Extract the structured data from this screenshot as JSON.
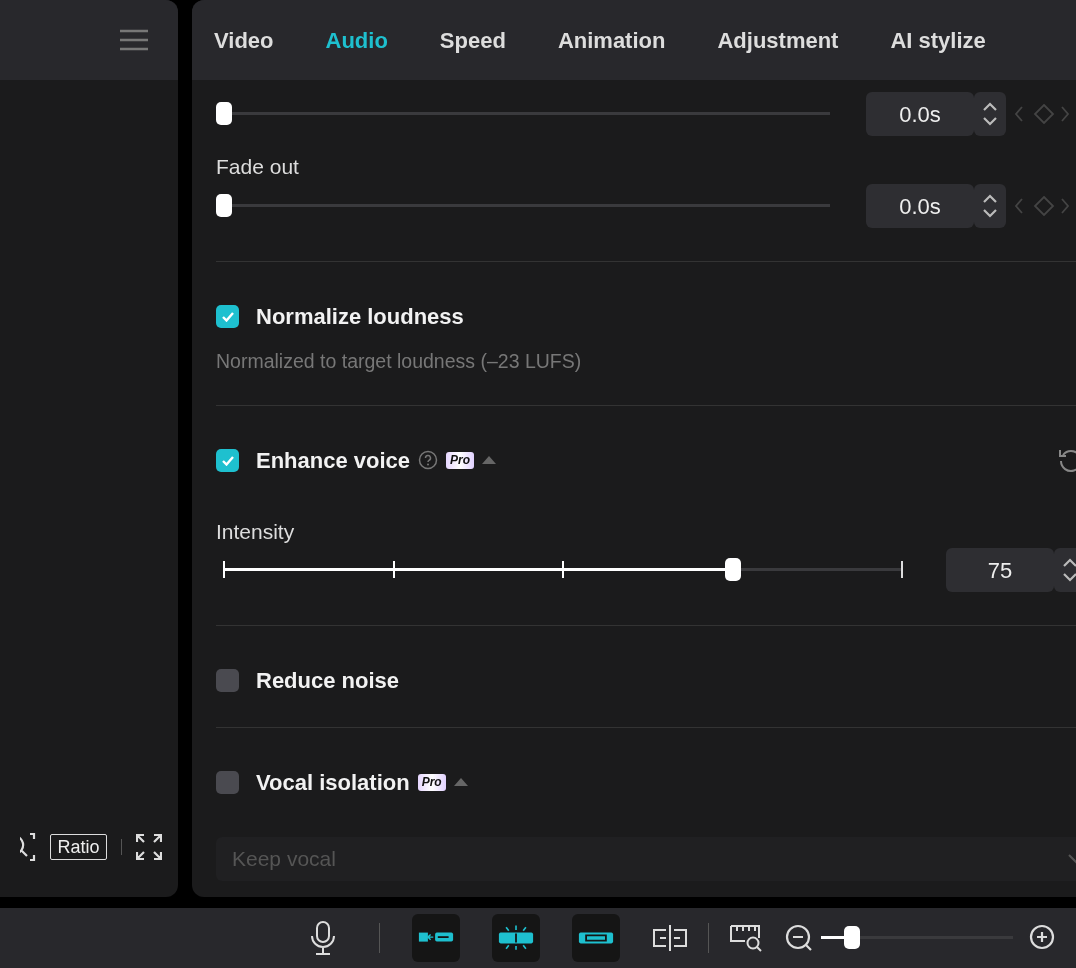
{
  "preview": {
    "ratio_button": "Ratio"
  },
  "tabs": [
    {
      "label": "Video",
      "selected": false
    },
    {
      "label": "Audio",
      "selected": true
    },
    {
      "label": "Speed",
      "selected": false
    },
    {
      "label": "Animation",
      "selected": false
    },
    {
      "label": "Adjustment",
      "selected": false
    },
    {
      "label": "AI stylize",
      "selected": false
    }
  ],
  "fades": [
    {
      "level": 0,
      "value": "0.0s"
    },
    {
      "label": "Fade out",
      "level": 0,
      "value": "0.0s"
    }
  ],
  "sections": [
    {
      "label": "Normalize loudness",
      "checked": true,
      "description": "Normalized to target loudness (–23 LUFS)"
    },
    {
      "label": "Enhance voice",
      "checked": true,
      "help": true,
      "badge": "Pro",
      "expanded": true,
      "reset": true,
      "slider": {
        "kind": "stepped",
        "label": "Intensity",
        "level": 0.75,
        "value": "75"
      }
    },
    {
      "label": "Reduce noise",
      "checked": false
    },
    {
      "label": "Vocal isolation",
      "checked": false,
      "badge": "Pro",
      "expanded": true,
      "dropdown": {
        "value": "Keep vocal",
        "disabled": true
      }
    }
  ],
  "toolbar": {
    "toggles": [
      {
        "on": true
      },
      {
        "on": true
      },
      {
        "on": true
      }
    ],
    "zoom": {
      "level": 0.16
    }
  }
}
